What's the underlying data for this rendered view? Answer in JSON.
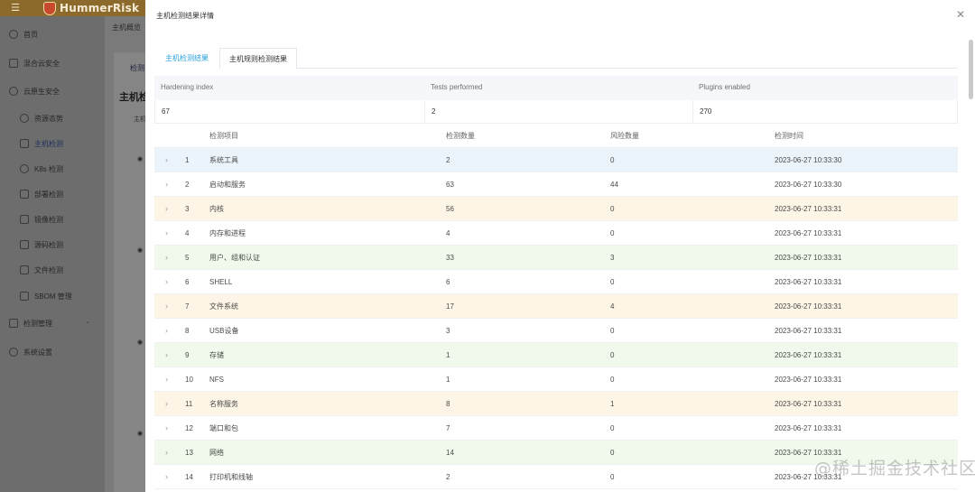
{
  "app": {
    "logo_text": "HummerRisk"
  },
  "sidebar": {
    "items": [
      {
        "label": "首页",
        "icon": "dashboard-icon"
      },
      {
        "label": "混合云安全",
        "icon": "cloud-icon"
      },
      {
        "label": "云原生安全",
        "icon": "cloud-native-icon"
      },
      {
        "label": "资源态势",
        "icon": "resource-icon"
      },
      {
        "label": "主机检测",
        "icon": "host-icon"
      },
      {
        "label": "K8s 检测",
        "icon": "k8s-icon"
      },
      {
        "label": "部署检测",
        "icon": "deploy-icon"
      },
      {
        "label": "镜像检测",
        "icon": "image-icon"
      },
      {
        "label": "源码检测",
        "icon": "code-icon"
      },
      {
        "label": "文件检测",
        "icon": "file-icon"
      },
      {
        "label": "SBOM 管理",
        "icon": "sbom-icon"
      },
      {
        "label": "检测管理",
        "icon": "manage-icon"
      },
      {
        "label": "系统设置",
        "icon": "settings-icon"
      }
    ]
  },
  "background": {
    "breadcrumb": "主机概览",
    "tab": "检测",
    "heading": "主机检",
    "sub": "主机"
  },
  "dialog": {
    "title": "主机检测结果详情",
    "tabs": [
      "主机检测结果",
      "主机规则检测结果"
    ],
    "summary": {
      "headers": [
        "Hardening index",
        "Tests performed",
        "Plugins enabled"
      ],
      "values": [
        "67",
        "2",
        "270"
      ]
    },
    "table": {
      "headers": [
        "检测项目",
        "检测数量",
        "风险数量",
        "检测时间"
      ],
      "rows": [
        {
          "idx": "1",
          "name": "系统工具",
          "count": "2",
          "risk": "0",
          "time": "2023-06-27 10:33:30",
          "color": "blue"
        },
        {
          "idx": "2",
          "name": "启动和服务",
          "count": "63",
          "risk": "44",
          "time": "2023-06-27 10:33:30",
          "color": "white"
        },
        {
          "idx": "3",
          "name": "内核",
          "count": "56",
          "risk": "0",
          "time": "2023-06-27 10:33:31",
          "color": "orange"
        },
        {
          "idx": "4",
          "name": "内存和进程",
          "count": "4",
          "risk": "0",
          "time": "2023-06-27 10:33:31",
          "color": "white"
        },
        {
          "idx": "5",
          "name": "用户、组和认证",
          "count": "33",
          "risk": "3",
          "time": "2023-06-27 10:33:31",
          "color": "green"
        },
        {
          "idx": "6",
          "name": "SHELL",
          "count": "6",
          "risk": "0",
          "time": "2023-06-27 10:33:31",
          "color": "white"
        },
        {
          "idx": "7",
          "name": "文件系统",
          "count": "17",
          "risk": "4",
          "time": "2023-06-27 10:33:31",
          "color": "orange"
        },
        {
          "idx": "8",
          "name": "USB设备",
          "count": "3",
          "risk": "0",
          "time": "2023-06-27 10:33:31",
          "color": "white"
        },
        {
          "idx": "9",
          "name": "存储",
          "count": "1",
          "risk": "0",
          "time": "2023-06-27 10:33:31",
          "color": "green"
        },
        {
          "idx": "10",
          "name": "NFS",
          "count": "1",
          "risk": "0",
          "time": "2023-06-27 10:33:31",
          "color": "white"
        },
        {
          "idx": "11",
          "name": "名称服务",
          "count": "8",
          "risk": "1",
          "time": "2023-06-27 10:33:31",
          "color": "orange"
        },
        {
          "idx": "12",
          "name": "端口和包",
          "count": "7",
          "risk": "0",
          "time": "2023-06-27 10:33:31",
          "color": "white"
        },
        {
          "idx": "13",
          "name": "网络",
          "count": "14",
          "risk": "0",
          "time": "2023-06-27 10:33:31",
          "color": "green"
        },
        {
          "idx": "14",
          "name": "打印机和线轴",
          "count": "2",
          "risk": "0",
          "time": "2023-06-27 10:33:31",
          "color": "white"
        }
      ]
    }
  },
  "watermark": "@稀土掘金技术社区"
}
